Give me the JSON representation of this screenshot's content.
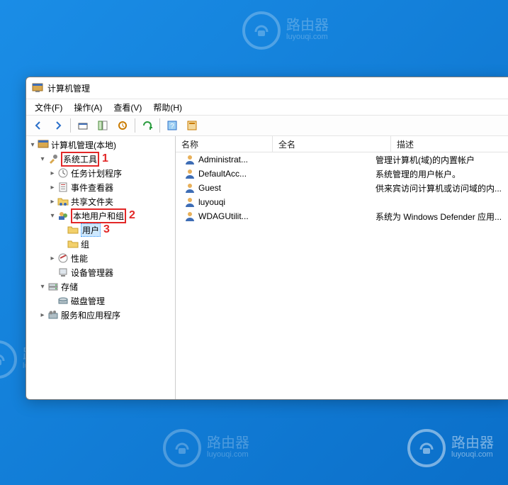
{
  "watermark": {
    "title": "路由器",
    "sub": "luyouqi.com"
  },
  "window": {
    "title": "计算机管理"
  },
  "menu": {
    "file": "文件(F)",
    "action": "操作(A)",
    "view": "查看(V)",
    "help": "帮助(H)"
  },
  "tree": {
    "root": "计算机管理(本地)",
    "sys_tools": "系统工具",
    "task_sched": "任务计划程序",
    "event_viewer": "事件查看器",
    "shared": "共享文件夹",
    "local_ug": "本地用户和组",
    "users": "用户",
    "groups": "组",
    "perf": "性能",
    "devmgr": "设备管理器",
    "storage": "存储",
    "diskmgr": "磁盘管理",
    "services_apps": "服务和应用程序"
  },
  "annot": {
    "a1": "1",
    "a2": "2",
    "a3": "3"
  },
  "columns": {
    "name": "名称",
    "full": "全名",
    "desc": "描述"
  },
  "users": [
    {
      "name": "Administrat...",
      "full": "",
      "desc": "管理计算机(域)的内置帐户"
    },
    {
      "name": "DefaultAcc...",
      "full": "",
      "desc": "系统管理的用户帐户。"
    },
    {
      "name": "Guest",
      "full": "",
      "desc": "供来宾访问计算机或访问域的内..."
    },
    {
      "name": "luyouqi",
      "full": "",
      "desc": ""
    },
    {
      "name": "WDAGUtilit...",
      "full": "",
      "desc": "系统为 Windows Defender 应用..."
    }
  ]
}
